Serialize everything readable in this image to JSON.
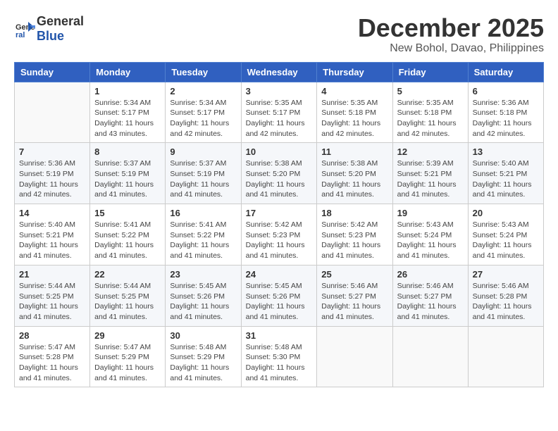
{
  "logo": {
    "general": "General",
    "blue": "Blue"
  },
  "title": "December 2025",
  "location": "New Bohol, Davao, Philippines",
  "headers": [
    "Sunday",
    "Monday",
    "Tuesday",
    "Wednesday",
    "Thursday",
    "Friday",
    "Saturday"
  ],
  "weeks": [
    [
      {
        "day": "",
        "info": ""
      },
      {
        "day": "1",
        "info": "Sunrise: 5:34 AM\nSunset: 5:17 PM\nDaylight: 11 hours\nand 43 minutes."
      },
      {
        "day": "2",
        "info": "Sunrise: 5:34 AM\nSunset: 5:17 PM\nDaylight: 11 hours\nand 42 minutes."
      },
      {
        "day": "3",
        "info": "Sunrise: 5:35 AM\nSunset: 5:17 PM\nDaylight: 11 hours\nand 42 minutes."
      },
      {
        "day": "4",
        "info": "Sunrise: 5:35 AM\nSunset: 5:18 PM\nDaylight: 11 hours\nand 42 minutes."
      },
      {
        "day": "5",
        "info": "Sunrise: 5:35 AM\nSunset: 5:18 PM\nDaylight: 11 hours\nand 42 minutes."
      },
      {
        "day": "6",
        "info": "Sunrise: 5:36 AM\nSunset: 5:18 PM\nDaylight: 11 hours\nand 42 minutes."
      }
    ],
    [
      {
        "day": "7",
        "info": "Sunrise: 5:36 AM\nSunset: 5:19 PM\nDaylight: 11 hours\nand 42 minutes."
      },
      {
        "day": "8",
        "info": "Sunrise: 5:37 AM\nSunset: 5:19 PM\nDaylight: 11 hours\nand 41 minutes."
      },
      {
        "day": "9",
        "info": "Sunrise: 5:37 AM\nSunset: 5:19 PM\nDaylight: 11 hours\nand 41 minutes."
      },
      {
        "day": "10",
        "info": "Sunrise: 5:38 AM\nSunset: 5:20 PM\nDaylight: 11 hours\nand 41 minutes."
      },
      {
        "day": "11",
        "info": "Sunrise: 5:38 AM\nSunset: 5:20 PM\nDaylight: 11 hours\nand 41 minutes."
      },
      {
        "day": "12",
        "info": "Sunrise: 5:39 AM\nSunset: 5:21 PM\nDaylight: 11 hours\nand 41 minutes."
      },
      {
        "day": "13",
        "info": "Sunrise: 5:40 AM\nSunset: 5:21 PM\nDaylight: 11 hours\nand 41 minutes."
      }
    ],
    [
      {
        "day": "14",
        "info": "Sunrise: 5:40 AM\nSunset: 5:21 PM\nDaylight: 11 hours\nand 41 minutes."
      },
      {
        "day": "15",
        "info": "Sunrise: 5:41 AM\nSunset: 5:22 PM\nDaylight: 11 hours\nand 41 minutes."
      },
      {
        "day": "16",
        "info": "Sunrise: 5:41 AM\nSunset: 5:22 PM\nDaylight: 11 hours\nand 41 minutes."
      },
      {
        "day": "17",
        "info": "Sunrise: 5:42 AM\nSunset: 5:23 PM\nDaylight: 11 hours\nand 41 minutes."
      },
      {
        "day": "18",
        "info": "Sunrise: 5:42 AM\nSunset: 5:23 PM\nDaylight: 11 hours\nand 41 minutes."
      },
      {
        "day": "19",
        "info": "Sunrise: 5:43 AM\nSunset: 5:24 PM\nDaylight: 11 hours\nand 41 minutes."
      },
      {
        "day": "20",
        "info": "Sunrise: 5:43 AM\nSunset: 5:24 PM\nDaylight: 11 hours\nand 41 minutes."
      }
    ],
    [
      {
        "day": "21",
        "info": "Sunrise: 5:44 AM\nSunset: 5:25 PM\nDaylight: 11 hours\nand 41 minutes."
      },
      {
        "day": "22",
        "info": "Sunrise: 5:44 AM\nSunset: 5:25 PM\nDaylight: 11 hours\nand 41 minutes."
      },
      {
        "day": "23",
        "info": "Sunrise: 5:45 AM\nSunset: 5:26 PM\nDaylight: 11 hours\nand 41 minutes."
      },
      {
        "day": "24",
        "info": "Sunrise: 5:45 AM\nSunset: 5:26 PM\nDaylight: 11 hours\nand 41 minutes."
      },
      {
        "day": "25",
        "info": "Sunrise: 5:46 AM\nSunset: 5:27 PM\nDaylight: 11 hours\nand 41 minutes."
      },
      {
        "day": "26",
        "info": "Sunrise: 5:46 AM\nSunset: 5:27 PM\nDaylight: 11 hours\nand 41 minutes."
      },
      {
        "day": "27",
        "info": "Sunrise: 5:46 AM\nSunset: 5:28 PM\nDaylight: 11 hours\nand 41 minutes."
      }
    ],
    [
      {
        "day": "28",
        "info": "Sunrise: 5:47 AM\nSunset: 5:28 PM\nDaylight: 11 hours\nand 41 minutes."
      },
      {
        "day": "29",
        "info": "Sunrise: 5:47 AM\nSunset: 5:29 PM\nDaylight: 11 hours\nand 41 minutes."
      },
      {
        "day": "30",
        "info": "Sunrise: 5:48 AM\nSunset: 5:29 PM\nDaylight: 11 hours\nand 41 minutes."
      },
      {
        "day": "31",
        "info": "Sunrise: 5:48 AM\nSunset: 5:30 PM\nDaylight: 11 hours\nand 41 minutes."
      },
      {
        "day": "",
        "info": ""
      },
      {
        "day": "",
        "info": ""
      },
      {
        "day": "",
        "info": ""
      }
    ]
  ]
}
